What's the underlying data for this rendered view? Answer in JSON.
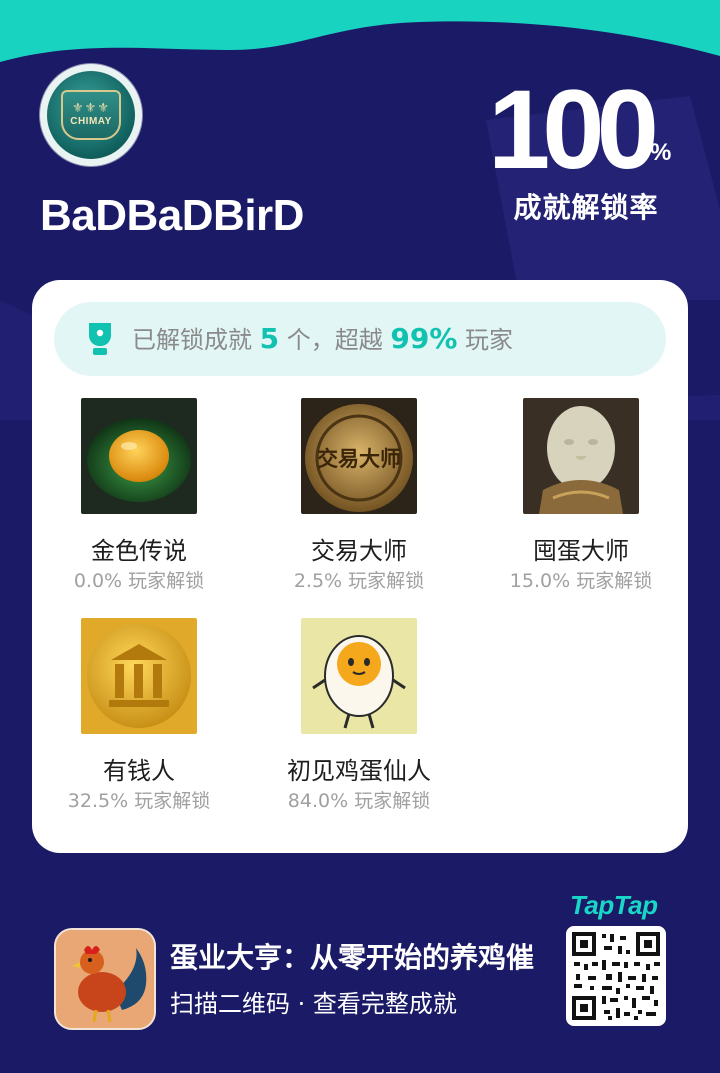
{
  "profile": {
    "username": "BaDBaDBirD",
    "avatar_text": "CHIMAY",
    "unlock_rate_value": "100",
    "unlock_rate_percent": "%",
    "unlock_rate_label": "成就解锁率"
  },
  "summary": {
    "prefix": "已解锁成就 ",
    "count": "5",
    "middle": " 个，超越 ",
    "beat_percent": "99%",
    "suffix": " 玩家",
    "icon": "trophy-icon"
  },
  "achievements": [
    {
      "name": "金色传说",
      "rate": "0.0% 玩家解锁",
      "image": "glass-egg-image"
    },
    {
      "name": "交易大师",
      "rate": "2.5% 玩家解锁",
      "image": "trade-master-coin-image",
      "image_text": "交易大师"
    },
    {
      "name": "囤蛋大师",
      "rate": "15.0% 玩家解锁",
      "image": "egg-statue-image"
    },
    {
      "name": "有钱人",
      "rate": "32.5% 玩家解锁",
      "image": "gold-bank-coin-image"
    },
    {
      "name": "初见鸡蛋仙人",
      "rate": "84.0% 玩家解锁",
      "image": "cartoon-egg-image"
    }
  ],
  "footer": {
    "brand": "TapTap",
    "game_title": "蛋业大亨：从零开始的养鸡催",
    "subtitle": "扫描二维码 · 查看完整成就",
    "game_icon": "rooster-icon",
    "qr_icon": "qr-code-icon"
  },
  "colors": {
    "background": "#1b1a66",
    "accent_teal": "#12c2b0",
    "top_band": "#19d3c1"
  }
}
